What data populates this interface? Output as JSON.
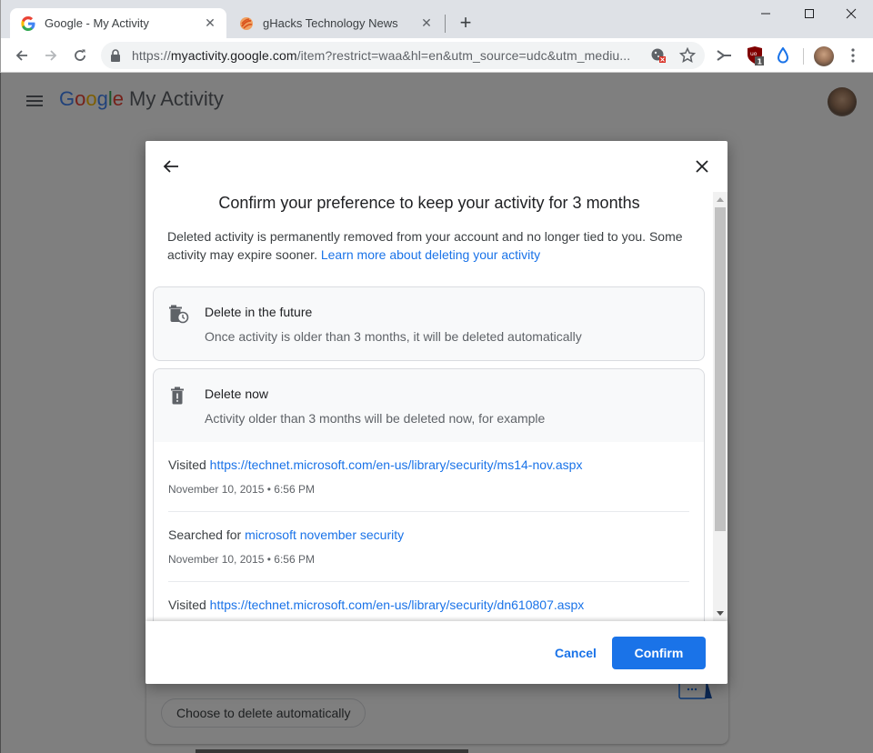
{
  "browser": {
    "tabs": [
      {
        "title": "Google - My Activity",
        "favicon": "google-g-icon",
        "active": true
      },
      {
        "title": "gHacks Technology News",
        "favicon": "ghacks-icon",
        "active": false
      }
    ],
    "new_tab_label": "+",
    "address_bar": {
      "scheme": "https://",
      "host": "myactivity.google.com",
      "rest": "/item?restrict=waa&hl=en&utm_source=udc&utm_mediu..."
    },
    "extensions": [
      {
        "icon": "cookie-blocked-icon"
      },
      {
        "icon": "bookmark-star-icon"
      },
      {
        "icon": "scissors-icon"
      },
      {
        "icon": "ublock-origin-icon",
        "badge": "1"
      },
      {
        "icon": "raindrop-icon"
      }
    ]
  },
  "page": {
    "brand_google": [
      "G",
      "o",
      "o",
      "g",
      "l",
      "e"
    ],
    "brand_product": "My Activity",
    "background_button": "Choose to delete automatically"
  },
  "dialog": {
    "title": "Confirm your preference to keep your activity for 3 months",
    "description": "Deleted activity is permanently removed from your account and no longer tied to you. Some activity may expire sooner.",
    "learn_more_link": "Learn more about deleting your activity",
    "options": [
      {
        "title": "Delete in the future",
        "subtitle": "Once activity is older than 3 months, it will be deleted automatically"
      },
      {
        "title": "Delete now",
        "subtitle": "Activity older than 3 months will be deleted now, for example"
      }
    ],
    "examples": [
      {
        "action": "Visited",
        "link": "https://technet.microsoft.com/en-us/library/security/ms14-nov.aspx",
        "time": "November 10, 2015 • 6:56 PM"
      },
      {
        "action": "Searched for",
        "link": "microsoft november security",
        "time": "November 10, 2015 • 6:56 PM"
      },
      {
        "action": "Visited",
        "link": "https://technet.microsoft.com/en-us/library/security/dn610807.aspx",
        "time": ""
      }
    ],
    "cancel_label": "Cancel",
    "confirm_label": "Confirm"
  },
  "colors": {
    "accent": "#1a73e8",
    "tabstrip": "#dee1e6",
    "scrim": "#000000"
  }
}
